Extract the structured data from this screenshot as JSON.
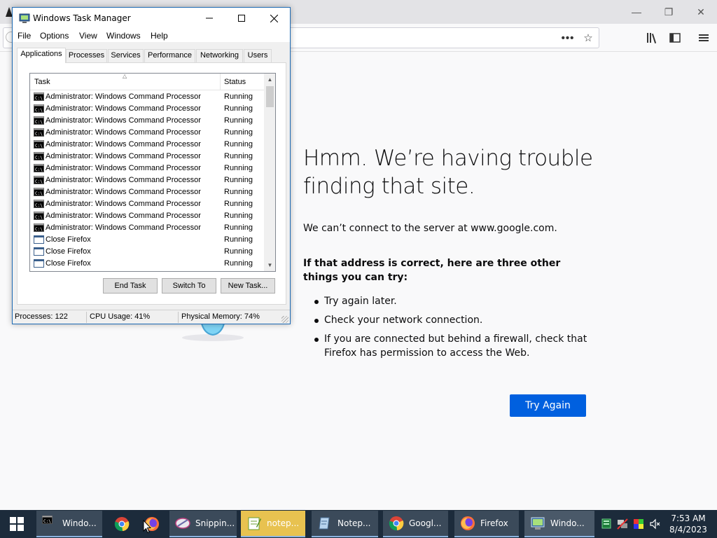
{
  "taskmgr": {
    "title": "Windows Task Manager",
    "menu": [
      "File",
      "Options",
      "View",
      "Windows",
      "Help"
    ],
    "tabs": [
      "Applications",
      "Processes",
      "Services",
      "Performance",
      "Networking",
      "Users"
    ],
    "columns": {
      "task": "Task",
      "status": "Status"
    },
    "rows": [
      {
        "task": "Administrator: Windows Command Processor",
        "status": "Running",
        "icon": "cmd-icon"
      },
      {
        "task": "Administrator: Windows Command Processor",
        "status": "Running",
        "icon": "cmd-icon"
      },
      {
        "task": "Administrator: Windows Command Processor",
        "status": "Running",
        "icon": "cmd-icon"
      },
      {
        "task": "Administrator: Windows Command Processor",
        "status": "Running",
        "icon": "cmd-icon"
      },
      {
        "task": "Administrator: Windows Command Processor",
        "status": "Running",
        "icon": "cmd-icon"
      },
      {
        "task": "Administrator: Windows Command Processor",
        "status": "Running",
        "icon": "cmd-icon"
      },
      {
        "task": "Administrator: Windows Command Processor",
        "status": "Running",
        "icon": "cmd-icon"
      },
      {
        "task": "Administrator: Windows Command Processor",
        "status": "Running",
        "icon": "cmd-icon"
      },
      {
        "task": "Administrator: Windows Command Processor",
        "status": "Running",
        "icon": "cmd-icon"
      },
      {
        "task": "Administrator: Windows Command Processor",
        "status": "Running",
        "icon": "cmd-icon"
      },
      {
        "task": "Administrator: Windows Command Processor",
        "status": "Running",
        "icon": "cmd-icon"
      },
      {
        "task": "Administrator: Windows Command Processor",
        "status": "Running",
        "icon": "cmd-icon"
      },
      {
        "task": "Close Firefox",
        "status": "Running",
        "icon": "window-icon"
      },
      {
        "task": "Close Firefox",
        "status": "Running",
        "icon": "window-icon"
      },
      {
        "task": "Close Firefox",
        "status": "Running",
        "icon": "window-icon"
      }
    ],
    "buttons": {
      "end_task": "End Task",
      "switch_to": "Switch To",
      "new_task": "New Task..."
    },
    "status": {
      "processes": "Processes: 122",
      "cpu": "CPU Usage: 41%",
      "memory": "Physical Memory: 74%"
    }
  },
  "firefox": {
    "error_title": "Hmm. We’re having trouble finding that site.",
    "error_desc": "We can’t connect to the server at www.google.com.",
    "error_sub": "If that address is correct, here are three other things you can try:",
    "suggestions": [
      "Try again later.",
      "Check your network connection.",
      "If you are connected but behind a firewall, check that Firefox has permission to access the Web."
    ],
    "try_again": "Try Again"
  },
  "taskbar": {
    "items": [
      {
        "label": "Windo...",
        "icon": "cmd-icon",
        "style": "btn"
      },
      {
        "label": "",
        "icon": "chrome-icon",
        "style": "pinned"
      },
      {
        "label": "",
        "icon": "firefox-icon",
        "style": "pinned"
      },
      {
        "label": "Snippin...",
        "icon": "snipping-tool-icon",
        "style": "btn"
      },
      {
        "label": "notep...",
        "icon": "notepad-plus-icon",
        "style": "highlight"
      },
      {
        "label": "Notep...",
        "icon": "notepad-icon",
        "style": "btn"
      },
      {
        "label": "Googl...",
        "icon": "chrome-icon",
        "style": "btn"
      },
      {
        "label": "Firefox",
        "icon": "firefox-icon",
        "style": "btn"
      },
      {
        "label": "Windo...",
        "icon": "task-manager-icon",
        "style": "active"
      }
    ],
    "clock_time": "7:53 AM",
    "clock_date": "8/4/2023"
  },
  "colors": {
    "accent": "#0060df",
    "taskbar": "#1c2b3b",
    "titlebar_border": "#1d6ab4"
  }
}
